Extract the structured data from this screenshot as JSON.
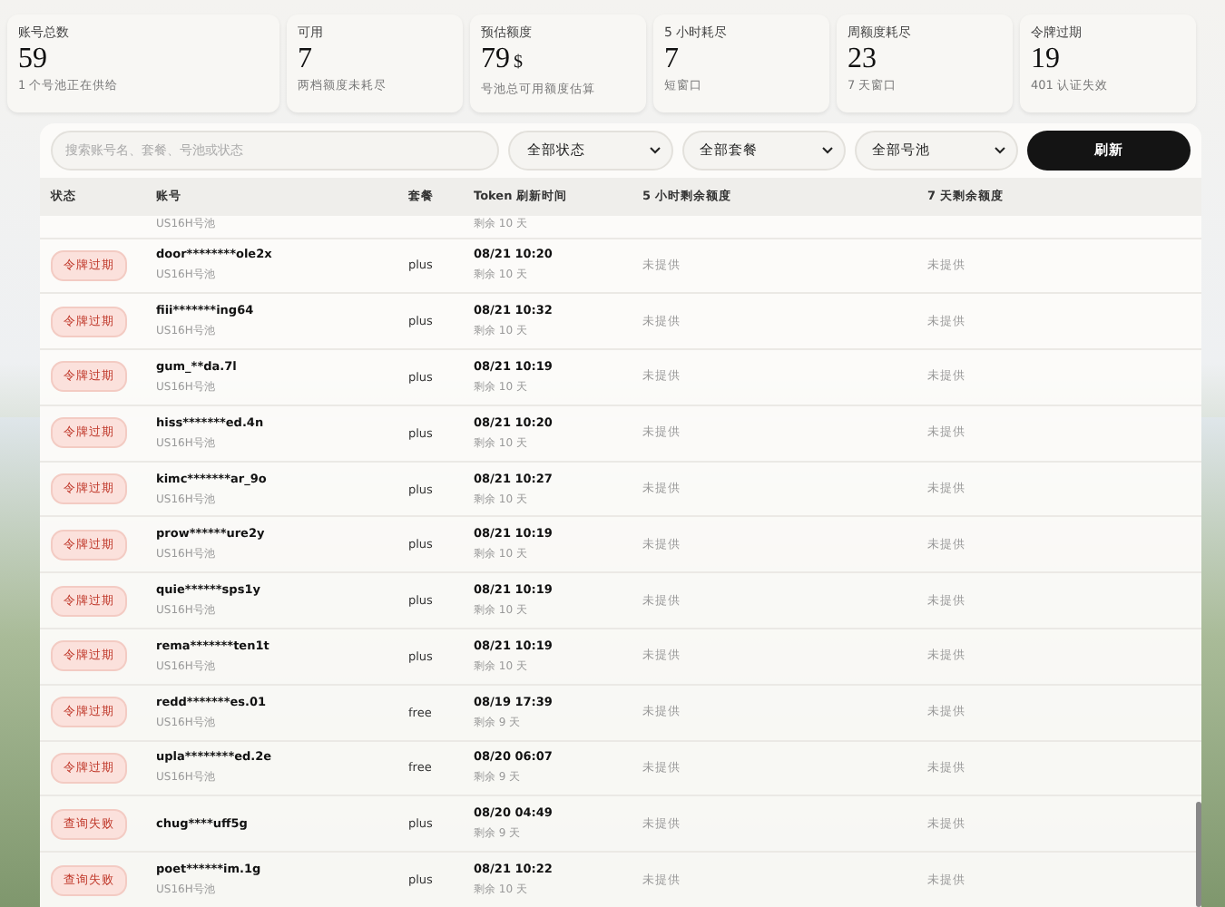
{
  "stats": [
    {
      "label": "账号总数",
      "value": "59",
      "note": "1 个号池正在供给"
    },
    {
      "label": "可用",
      "value": "7",
      "note": "两档额度未耗尽"
    },
    {
      "label": "预估额度",
      "value": "79",
      "unit": "$",
      "note": "号池总可用额度估算"
    },
    {
      "label": "5 小时耗尽",
      "value": "7",
      "note": "短窗口"
    },
    {
      "label": "周额度耗尽",
      "value": "23",
      "note": "7 天窗口"
    },
    {
      "label": "令牌过期",
      "value": "19",
      "note": "401 认证失效"
    }
  ],
  "toolbar": {
    "search": {
      "placeholder": "搜索账号名、套餐、号池或状态"
    },
    "filters": [
      "全部状态",
      "全部套餐",
      "全部号池"
    ],
    "refresh": "刷新"
  },
  "table": {
    "columns": [
      "状态",
      "账号",
      "套餐",
      "Token 刷新时间",
      "5 小时剩余额度",
      "7 天剩余额度"
    ],
    "partial_row": {
      "pool": "US16H号池",
      "remain": "剩余 10 天"
    },
    "rows": [
      {
        "status": "令牌过期",
        "account": "door********ole2x",
        "pool": "US16H号池",
        "plan": "plus",
        "time": "08/21 10:20",
        "remain": "剩余 10 天",
        "h5": "未提供",
        "d7": "未提供"
      },
      {
        "status": "令牌过期",
        "account": "fiii*******ing64",
        "pool": "US16H号池",
        "plan": "plus",
        "time": "08/21 10:32",
        "remain": "剩余 10 天",
        "h5": "未提供",
        "d7": "未提供"
      },
      {
        "status": "令牌过期",
        "account": "gum_**da.7l",
        "pool": "US16H号池",
        "plan": "plus",
        "time": "08/21 10:19",
        "remain": "剩余 10 天",
        "h5": "未提供",
        "d7": "未提供"
      },
      {
        "status": "令牌过期",
        "account": "hiss*******ed.4n",
        "pool": "US16H号池",
        "plan": "plus",
        "time": "08/21 10:20",
        "remain": "剩余 10 天",
        "h5": "未提供",
        "d7": "未提供"
      },
      {
        "status": "令牌过期",
        "account": "kimc*******ar_9o",
        "pool": "US16H号池",
        "plan": "plus",
        "time": "08/21 10:27",
        "remain": "剩余 10 天",
        "h5": "未提供",
        "d7": "未提供"
      },
      {
        "status": "令牌过期",
        "account": "prow******ure2y",
        "pool": "US16H号池",
        "plan": "plus",
        "time": "08/21 10:19",
        "remain": "剩余 10 天",
        "h5": "未提供",
        "d7": "未提供"
      },
      {
        "status": "令牌过期",
        "account": "quie******sps1y",
        "pool": "US16H号池",
        "plan": "plus",
        "time": "08/21 10:19",
        "remain": "剩余 10 天",
        "h5": "未提供",
        "d7": "未提供"
      },
      {
        "status": "令牌过期",
        "account": "rema*******ten1t",
        "pool": "US16H号池",
        "plan": "plus",
        "time": "08/21 10:19",
        "remain": "剩余 10 天",
        "h5": "未提供",
        "d7": "未提供"
      },
      {
        "status": "令牌过期",
        "account": "redd*******es.01",
        "pool": "US16H号池",
        "plan": "free",
        "time": "08/19 17:39",
        "remain": "剩余 9 天",
        "h5": "未提供",
        "d7": "未提供"
      },
      {
        "status": "令牌过期",
        "account": "upla********ed.2e",
        "pool": "US16H号池",
        "plan": "free",
        "time": "08/20 06:07",
        "remain": "剩余 9 天",
        "h5": "未提供",
        "d7": "未提供"
      },
      {
        "status": "查询失败",
        "account": "chug****uff5g",
        "plan": "plus",
        "time": "08/20 04:49",
        "remain": "剩余 9 天",
        "h5": "未提供",
        "d7": "未提供"
      },
      {
        "status": "查询失败",
        "account": "poet******im.1g",
        "pool": "US16H号池",
        "plan": "plus",
        "time": "08/21 10:22",
        "remain": "剩余 10 天",
        "h5": "未提供",
        "d7": "未提供"
      }
    ]
  }
}
